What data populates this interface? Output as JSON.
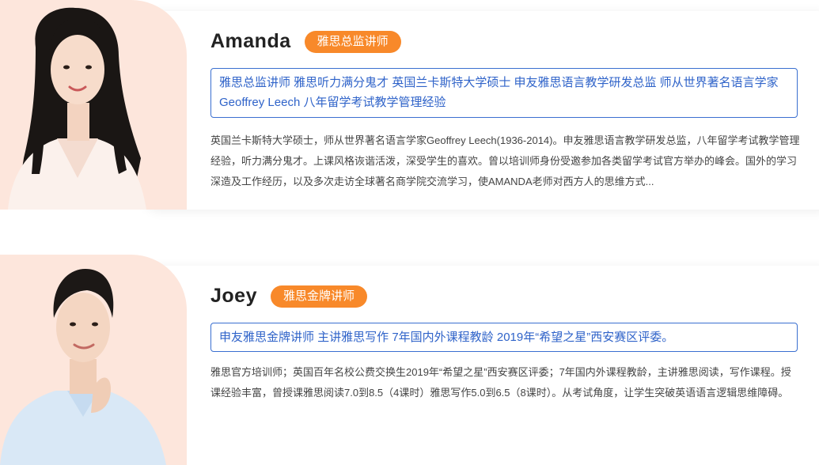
{
  "teachers": [
    {
      "name": "Amanda",
      "title": "雅思总监讲师",
      "summary": "雅思总监讲师 雅思听力满分鬼才 英国兰卡斯特大学硕士 申友雅思语言教学研发总监 师从世界著名语言学家Geoffrey Leech 八年留学考试教学管理经验",
      "description": "英国兰卡斯特大学硕士，师从世界著名语言学家Geoffrey Leech(1936-2014)。申友雅思语言教学研发总监，八年留学考试教学管理经验，听力满分鬼才。上课风格诙谐活泼，深受学生的喜欢。曾以培训师身份受邀参加各类留学考试官方举办的峰会。国外的学习深造及工作经历，以及多次走访全球著名商学院交流学习，使AMANDA老师对西方人的思维方式..."
    },
    {
      "name": "Joey",
      "title": "雅思金牌讲师",
      "summary": "申友雅思金牌讲师 主讲雅思写作 7年国内外课程教龄 2019年“希望之星”西安赛区评委。",
      "description": "雅思官方培训师；英国百年名校公费交换生2019年“希望之星”西安赛区评委；7年国内外课程教龄，主讲雅思阅读，写作课程。授课经验丰富，曾授课雅思阅读7.0到8.5（4课时）雅思写作5.0到6.5（8课时）。从考试角度，让学生突破英语语言逻辑思维障碍。"
    }
  ],
  "colors": {
    "badge": "#f8892a",
    "summary_border": "#3a6fd0",
    "summary_text": "#2f63c9",
    "photo_bg": "#fde6dc"
  }
}
